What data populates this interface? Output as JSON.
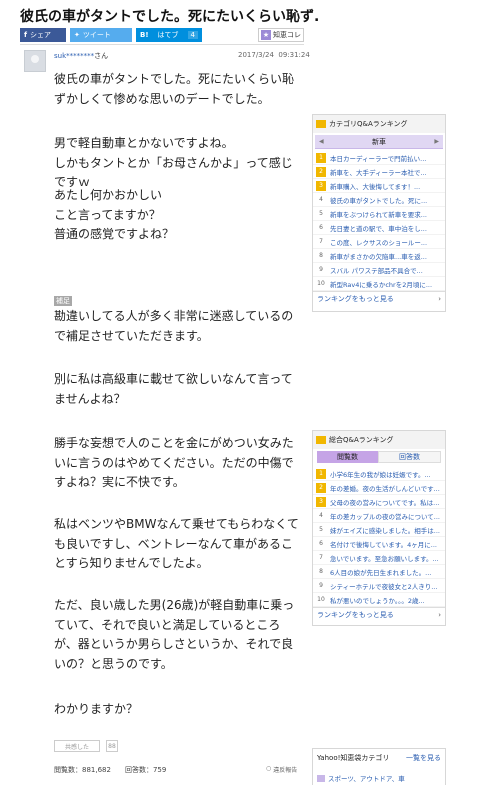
{
  "title": "彼氏の車がタントでした。死にたいくらい恥ず...",
  "share": {
    "facebook": "シェア",
    "twitter": "ツイート",
    "hatena_label": "はてブ",
    "hatena_count": "4",
    "chiebukuro": "知恵コレ"
  },
  "question": {
    "user": "suk********",
    "user_suffix": "さん",
    "date": "2017/3/24",
    "time": "09:31:24",
    "paragraphs": [
      "彼氏の車がタントでした。死にたいくらい恥ずかしくて惨めな思いのデートでした。",
      "男で軽自動車とかないですよね。\nしかもタントとか「お母さんかよ」って感じですｗ",
      "あたし何かおかしい\nこと言ってますか？\n普通の感覚ですよね？"
    ],
    "supplement_label": "補足",
    "supplement": [
      "勘違いしてる人が多く非常に迷惑しているので補足させていただきます。",
      "別に私は高級車に載せて欲しいなんて言ってませんよね？",
      "勝手な妄想で人のことを金にがめつい女みたいに言うのはやめてください。ただの中傷ですよね？実に不快です。",
      "私はベンツやBMWなんて乗せてもらわなくても良いですし、ベントレーなんて車があることすら知りませんでしたよ。",
      "ただ、良い歳した男(26歳)が軽自動車に乗っていて、それで良いと満足しているところが、器というか男らしさというか、それで良いの？と思うのです。",
      "わかりますか？"
    ],
    "empathy_button": "共感した",
    "empathy_count": "88",
    "views_label": "閲覧数：881,682",
    "answers_label": "回答数：759",
    "report_label": "違反報告"
  },
  "ranking_category": {
    "title": "カテゴリQ&Aランキング",
    "tab": "新車",
    "items": [
      {
        "no": "1",
        "text": "本日カーディーラーで門前払い..."
      },
      {
        "no": "2",
        "text": "新車を、大手ディーラー本社で..."
      },
      {
        "no": "3",
        "text": "新車購入、大後悔してます！..."
      },
      {
        "no": "4",
        "text": "彼氏の車がタントでした。死に..."
      },
      {
        "no": "5",
        "text": "新車をぶつけられて新車を要求..."
      },
      {
        "no": "6",
        "text": "先日妻と道の駅で、車中泊をし..."
      },
      {
        "no": "7",
        "text": "この度、レクサスのショールー..."
      },
      {
        "no": "8",
        "text": "新車がまさかの欠陥車...車を返..."
      },
      {
        "no": "9",
        "text": "スバル パワステ部品不具合で..."
      },
      {
        "no": "10",
        "text": "新型Rav4に乗るかchrを2月頃に..."
      }
    ],
    "more": "ランキングをもっと見る"
  },
  "ranking_general": {
    "title": "総合Q&Aランキング",
    "tabs": [
      "閲覧数",
      "回答数"
    ],
    "items": [
      {
        "no": "1",
        "text": "小学6年生の我が娘は妊娠です。..."
      },
      {
        "no": "2",
        "text": "年の差婚。夜の生活がしんどいです..."
      },
      {
        "no": "3",
        "text": "父母の夜の営みについてです。私は..."
      },
      {
        "no": "4",
        "text": "年の差カップルの夜の営みについて..."
      },
      {
        "no": "5",
        "text": "妹がエイズに感染しました。相手は..."
      },
      {
        "no": "6",
        "text": "名付けで後悔しています。4ヶ月に..."
      },
      {
        "no": "7",
        "text": "急いでいます。至急お願いします。..."
      },
      {
        "no": "8",
        "text": "6人目の娘が先日生まれました。..."
      },
      {
        "no": "9",
        "text": "シティーホテルで夜彼女と2人きり..."
      },
      {
        "no": "10",
        "text": "私が悪いのでしょうか。。。2歳..."
      }
    ],
    "more": "ランキングをもっと見る"
  },
  "category_panel": {
    "title": "Yahoo!知恵袋カテゴリ",
    "link": "一覧を見る",
    "first_item": "スポーツ、アウトドア、車"
  }
}
